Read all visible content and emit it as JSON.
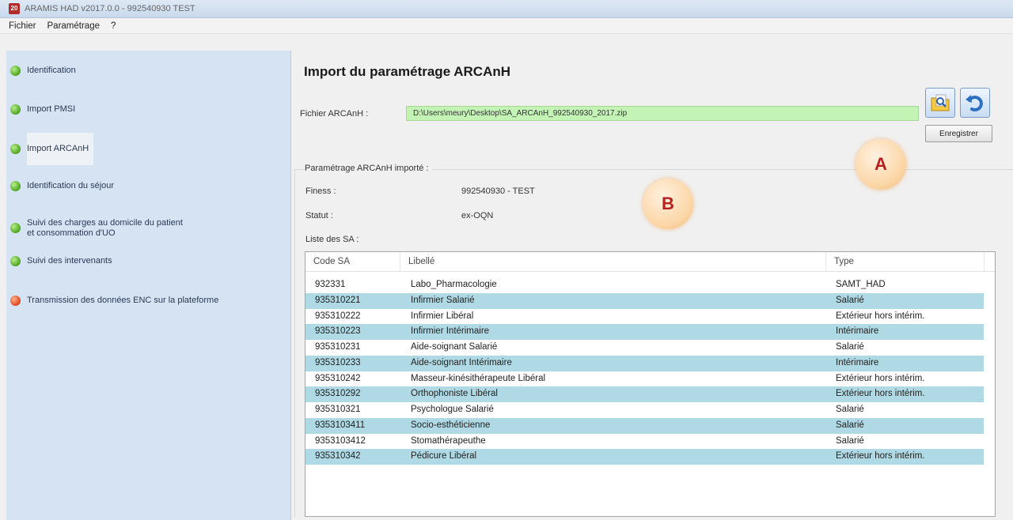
{
  "window": {
    "title": "ARAMIS HAD v2017.0.0  -  992540930  TEST",
    "icon_text": "20"
  },
  "menu": [
    "Fichier",
    "Paramétrage",
    "?"
  ],
  "sidebar": {
    "items": [
      {
        "label": "Identification",
        "status": "green"
      },
      {
        "label": "Import PMSI",
        "status": "green"
      },
      {
        "label": "Import ARCAnH",
        "status": "green",
        "active": true
      },
      {
        "label": "Identification du séjour",
        "status": "green"
      },
      {
        "label_line1": "Suivi des charges au domicile du patient",
        "label_line2": "et consommation d'UO",
        "status": "green"
      },
      {
        "label": "Suivi des intervenants",
        "status": "green"
      },
      {
        "label": "Transmission des données ENC sur la plateforme",
        "status": "red"
      }
    ]
  },
  "main": {
    "title": "Import du paramétrage ARCAnH",
    "file_label": "Fichier ARCAnH :",
    "file_value": "D:\\Users\\meury\\Desktop\\SA_ARCAnH_992540930_2017.zip",
    "save_label": "Enregistrer",
    "group_title": "Paramétrage ARCAnH importé :",
    "finess_label": "Finess :",
    "finess_value": "992540930 - TEST",
    "statut_label": "Statut :",
    "statut_value": "ex-OQN",
    "liste_label": "Liste des SA :"
  },
  "table": {
    "columns": [
      "Code SA",
      "Libellé",
      "Type"
    ],
    "rows": [
      [
        "932331",
        "Labo_Pharmacologie",
        "SAMT_HAD"
      ],
      [
        "935310221",
        "Infirmier Salarié",
        "Salarié"
      ],
      [
        "935310222",
        "Infirmier Libéral",
        "Extérieur hors intérim."
      ],
      [
        "935310223",
        "Infirmier Intérimaire",
        "Intérimaire"
      ],
      [
        "935310231",
        "Aide-soignant Salarié",
        "Salarié"
      ],
      [
        "935310233",
        "Aide-soignant Intérimaire",
        "Intérimaire"
      ],
      [
        "935310242",
        "Masseur-kinésithérapeute Libéral",
        "Extérieur hors intérim."
      ],
      [
        "935310292",
        "Orthophoniste Libéral",
        "Extérieur hors intérim."
      ],
      [
        "935310321",
        "Psychologue Salarié",
        "Salarié"
      ],
      [
        "9353103411",
        "Socio-esthéticienne",
        "Salarié"
      ],
      [
        "9353103412",
        "Stomathérapeuthe",
        "Salarié"
      ],
      [
        "935310342",
        "Pédicure Libéral",
        "Extérieur hors intérim."
      ]
    ]
  },
  "callouts": {
    "a": "A",
    "b": "B"
  },
  "colors": {
    "sidebar_bg": "#d6e3f3",
    "file_input_bg": "#c4f3b6",
    "row_alt": "#afd9e4",
    "status_green": "#4ea51f",
    "status_red": "#e0461f",
    "callout_text": "#b81f1f"
  }
}
